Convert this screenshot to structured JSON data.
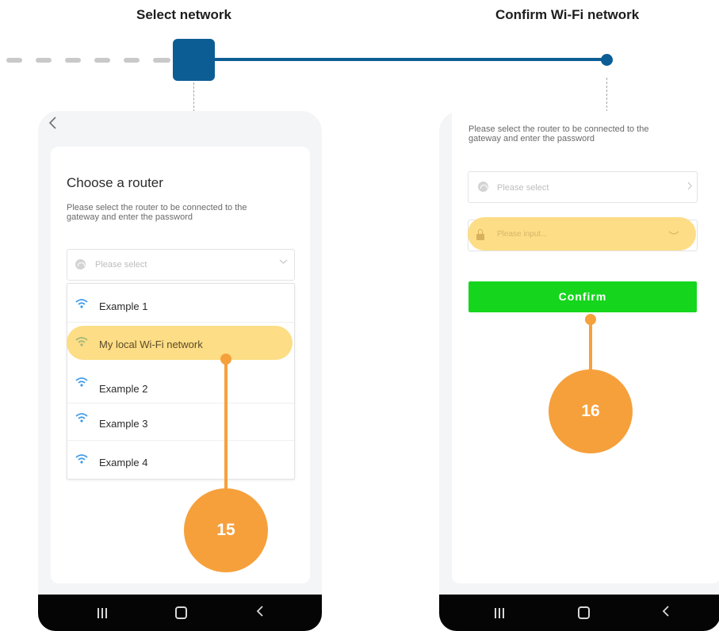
{
  "steps": [
    {
      "title": "Select network"
    },
    {
      "title": "Confirm Wi-Fi network"
    }
  ],
  "colors": {
    "step_accent": "#0d5d95",
    "callout": "#f6a03c",
    "highlight": "#fdda7b",
    "confirm_button": "#15d61d"
  },
  "phone1": {
    "back_icon": "chevron-left-icon",
    "title": "Choose a router",
    "description": "Please select the router to be connected to the gateway and enter the password",
    "network_select": {
      "placeholder": "Please select",
      "icon": "wifi-icon",
      "chevron": "chevron-down-icon"
    },
    "dropdown_items": [
      {
        "label": "Example 1"
      },
      {
        "label": "My local Wi-Fi network",
        "highlighted": true
      },
      {
        "label": "Example 2"
      },
      {
        "label": "Example 3"
      },
      {
        "label": "Example 4"
      }
    ],
    "callout_number": "15",
    "nav": [
      "recent-apps-icon",
      "home-icon",
      "back-icon"
    ]
  },
  "phone2": {
    "description": "Please select the router to be connected to the gateway and enter the password",
    "network_select": {
      "placeholder": "Please select",
      "icon": "wifi-icon",
      "chevron": "chevron-right-icon"
    },
    "password_field": {
      "placeholder": "Please input...",
      "icon": "lock-icon",
      "toggle": "eye-closed-icon"
    },
    "confirm_label": "Confirm",
    "callout_number": "16",
    "nav": [
      "recent-apps-icon",
      "home-icon",
      "back-icon"
    ]
  }
}
